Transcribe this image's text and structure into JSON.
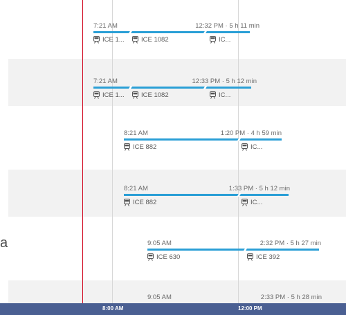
{
  "sidebar_fragment": "a",
  "timeline": {
    "labels": [
      "8:00 AM",
      "12:00 PM"
    ]
  },
  "connections": [
    {
      "dep": "7:21 AM",
      "arr_prefix": "12:32 PM",
      "duration": "5 h 11 min",
      "legs": [
        "ICE 1...",
        "ICE 1082",
        "IC..."
      ]
    },
    {
      "dep": "7:21 AM",
      "arr_prefix": "12:33 PM",
      "duration": "5 h 12 min",
      "legs": [
        "ICE 1...",
        "ICE 1082",
        "IC..."
      ]
    },
    {
      "dep": "8:21 AM",
      "arr_prefix": "1:20 PM",
      "duration": "4 h 59 min",
      "legs": [
        "ICE 882",
        "IC..."
      ]
    },
    {
      "dep": "8:21 AM",
      "arr_prefix": "1:33 PM",
      "duration": "5 h 12 min",
      "legs": [
        "ICE 882",
        "IC..."
      ]
    },
    {
      "dep": "9:05 AM",
      "arr_prefix": "2:32 PM",
      "duration": "5 h 27 min",
      "legs": [
        "ICE 630",
        "ICE 392"
      ]
    },
    {
      "dep": "9:05 AM",
      "arr_prefix": "2:33 PM",
      "duration": "5 h 28 min",
      "legs": []
    }
  ],
  "colors": {
    "bar": "#2a9fd6",
    "footer": "#4a5f92",
    "now_line": "#d0021b"
  }
}
